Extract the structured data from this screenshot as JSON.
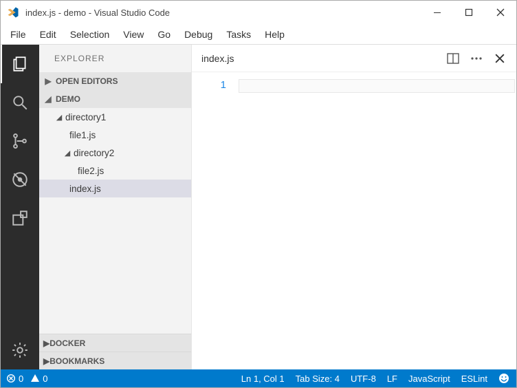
{
  "window": {
    "title": "index.js - demo - Visual Studio Code"
  },
  "menu": {
    "items": [
      "File",
      "Edit",
      "Selection",
      "View",
      "Go",
      "Debug",
      "Tasks",
      "Help"
    ]
  },
  "sidebar": {
    "title": "EXPLORER",
    "sections": {
      "open_editors": "OPEN EDITORS",
      "folder": "DEMO",
      "docker": "DOCKER",
      "bookmarks": "BOOKMARKS"
    },
    "tree": {
      "dir1": "directory1",
      "file1": "file1.js",
      "dir2": "directory2",
      "file2": "file2.js",
      "index": "index.js"
    }
  },
  "editor": {
    "tab": "index.js",
    "gutter": {
      "line1": "1"
    }
  },
  "statusbar": {
    "errors": "0",
    "warnings": "0",
    "cursor": "Ln 1, Col 1",
    "tabsize": "Tab Size: 4",
    "encoding": "UTF-8",
    "eol": "LF",
    "language": "JavaScript",
    "linter": "ESLint"
  }
}
